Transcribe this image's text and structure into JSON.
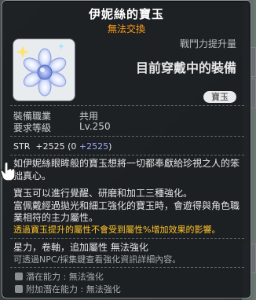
{
  "tooltip": {
    "title": "伊妮絲的寶玉",
    "trade_status": "無法交換",
    "combat_power_label": "戰鬥力提升量",
    "equipped_label": "目前穿戴中的裝備",
    "category_badge": "寶玉",
    "requirements": {
      "job_label": "裝備職業",
      "job_value": "共用",
      "level_label": "要求等級",
      "level_value": "Lv.250"
    },
    "stat": {
      "name": "STR",
      "total": "+2525",
      "open_paren": "(0 ",
      "bonus": "+2525",
      "close_paren": ")"
    },
    "description": {
      "flavor_line1": "如伊妮絲眼眸般的寶玉想將一切都奉獻給珍視之人的笨",
      "flavor_line2": "拙真心。",
      "info_line1": "寶玉可以進行覺醒、研磨和加工三種強化。",
      "info_line2": "富佩戴經過拋光和細工強化的寶玉時，會遊得與角色職",
      "info_line3": "業相符的主力屬性。"
    },
    "warning": "透過寶玉提升的屬性不會受到屬性%增加效果的影響。",
    "enhance_line": "星力，卷軸，追加屬性  無法強化",
    "npc_line": "可透過NPC/採集鍵查看強化資訊詳細內容。",
    "potential": {
      "label": "潛在能力",
      "value": "無法強化"
    },
    "additional_potential": {
      "label": "附加潛在能力",
      "value": "無法強化"
    }
  },
  "colors": {
    "title": "#ffffff",
    "trade_status": "#ff9f1a",
    "warning": "#ffc327",
    "stat_bonus": "#9aa8ff"
  },
  "icons": {
    "item": "jewel-icon",
    "cursor": "hand-pointer-icon",
    "potential": "potential-icon"
  }
}
